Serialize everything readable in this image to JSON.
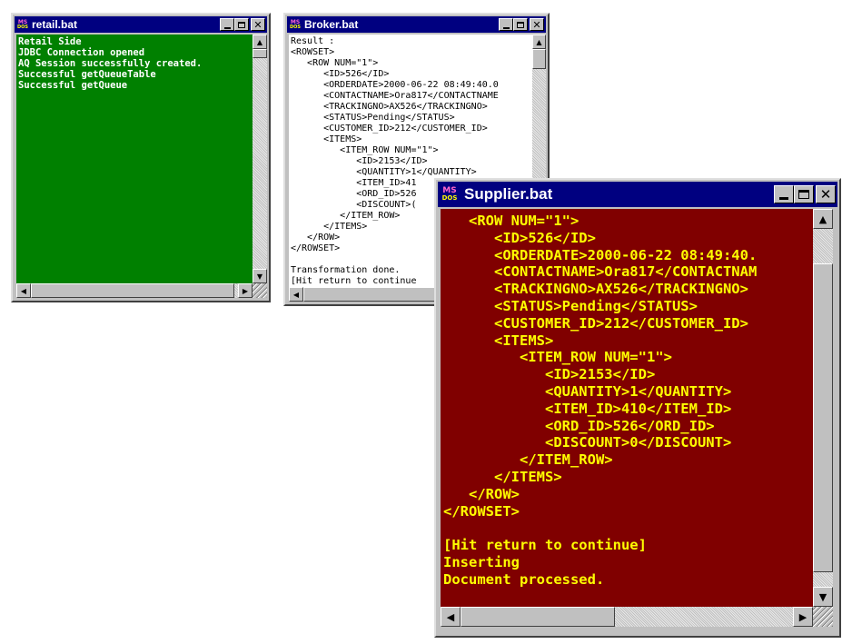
{
  "retail": {
    "title": "retail.bat",
    "icon": "ms-dos-icon",
    "bg": "#008000",
    "fg": "#ffffff",
    "lines": [
      "Retail Side",
      "JDBC Connection opened",
      "AQ Session successfully created.",
      "Successful getQueueTable",
      "Successful getQueue"
    ]
  },
  "broker": {
    "title": "Broker.bat",
    "icon": "ms-dos-icon",
    "bg": "#ffffff",
    "fg": "#000000",
    "lines": [
      "Result :",
      "<ROWSET>",
      "   <ROW NUM=\"1\">",
      "      <ID>526</ID>",
      "      <ORDERDATE>2000-06-22 08:49:40.0",
      "      <CONTACTNAME>Ora817</CONTACTNAME",
      "      <TRACKINGNO>AX526</TRACKINGNO>",
      "      <STATUS>Pending</STATUS>",
      "      <CUSTOMER_ID>212</CUSTOMER_ID>",
      "      <ITEMS>",
      "         <ITEM_ROW NUM=\"1\">",
      "            <ID>2153</ID>",
      "            <QUANTITY>1</QUANTITY>",
      "            <ITEM_ID>41",
      "            <ORD_ID>526",
      "            <DISCOUNT>(",
      "         </ITEM_ROW>",
      "      </ITEMS>",
      "   </ROW>",
      "</ROWSET>",
      "",
      "Transformation done.",
      "[Hit return to continue"
    ]
  },
  "supplier": {
    "title": "Supplier.bat",
    "icon": "ms-dos-icon",
    "bg": "#800000",
    "fg": "#ffff00",
    "lines": [
      "   <ROW NUM=\"1\">",
      "      <ID>526</ID>",
      "      <ORDERDATE>2000-06-22 08:49:40.",
      "      <CONTACTNAME>Ora817</CONTACTNAM",
      "      <TRACKINGNO>AX526</TRACKINGNO>",
      "      <STATUS>Pending</STATUS>",
      "      <CUSTOMER_ID>212</CUSTOMER_ID>",
      "      <ITEMS>",
      "         <ITEM_ROW NUM=\"1\">",
      "            <ID>2153</ID>",
      "            <QUANTITY>1</QUANTITY>",
      "            <ITEM_ID>410</ITEM_ID>",
      "            <ORD_ID>526</ORD_ID>",
      "            <DISCOUNT>0</DISCOUNT>",
      "         </ITEM_ROW>",
      "      </ITEMS>",
      "   </ROW>",
      "</ROWSET>",
      "",
      "[Hit return to continue]",
      "Inserting",
      "Document processed."
    ]
  },
  "window_icons": {
    "ms_label": "MS",
    "dos_label": "DOS",
    "minimize": "minimize-icon",
    "maximize": "maximize-icon",
    "close": "close-icon"
  }
}
